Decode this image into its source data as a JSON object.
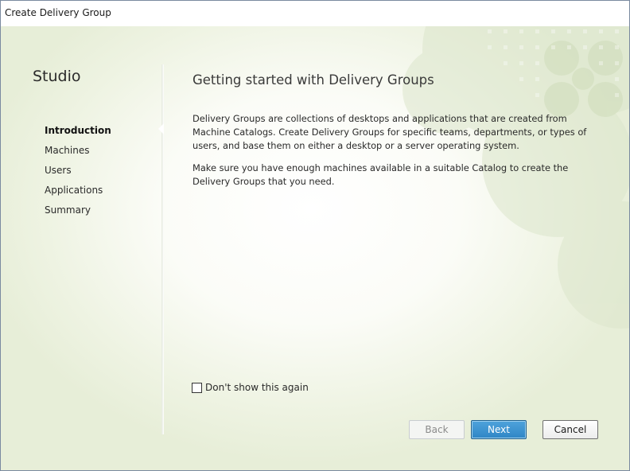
{
  "window": {
    "title": "Create Delivery Group"
  },
  "sidebar": {
    "title": "Studio",
    "items": [
      {
        "label": "Introduction",
        "active": true
      },
      {
        "label": "Machines",
        "active": false
      },
      {
        "label": "Users",
        "active": false
      },
      {
        "label": "Applications",
        "active": false
      },
      {
        "label": "Summary",
        "active": false
      }
    ]
  },
  "main": {
    "heading": "Getting started with Delivery Groups",
    "paragraph1": "Delivery Groups are collections of desktops and applications that are created from Machine Catalogs. Create Delivery Groups for specific teams, departments, or types of users, and base them on either a desktop or a server operating system.",
    "paragraph2": "Make sure you have enough machines available in a suitable Catalog to create the Delivery Groups that you need.",
    "dont_show_label": "Don't show this again",
    "dont_show_checked": false
  },
  "footer": {
    "back_label": "Back",
    "next_label": "Next",
    "cancel_label": "Cancel"
  },
  "colors": {
    "accent": "#2f86c5",
    "background_tint": "#e7eed8",
    "decor_green": "#d9e4c8"
  }
}
